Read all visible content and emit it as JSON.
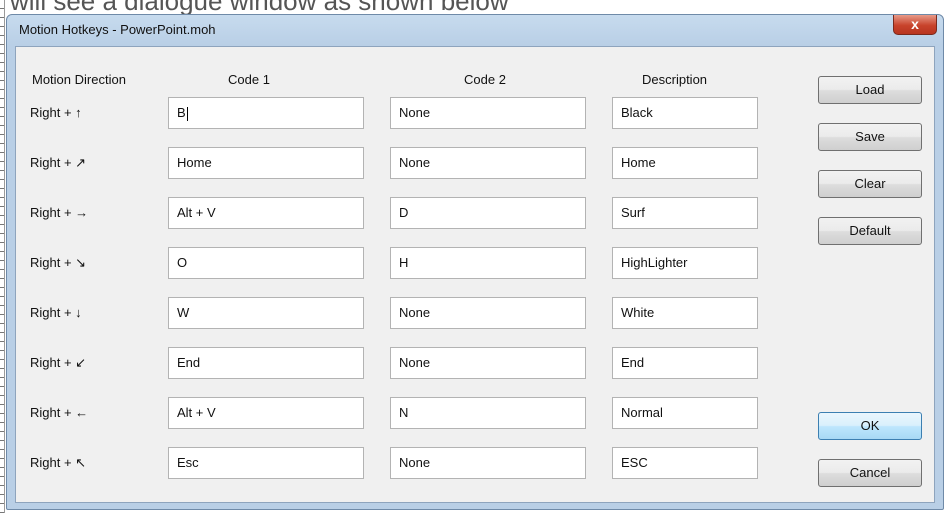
{
  "caption": "will see a dialogue window as shown below",
  "window": {
    "title": "Motion Hotkeys - PowerPoint.moh",
    "close_glyph": "x"
  },
  "headers": {
    "motion_direction": "Motion Direction",
    "code1": "Code 1",
    "code2": "Code 2",
    "description": "Description"
  },
  "rows": [
    {
      "direction": "Right + ↑",
      "code1": "B",
      "code2": "None",
      "description": "Black"
    },
    {
      "direction": "Right + ↗",
      "code1": "Home",
      "code2": "None",
      "description": "Home"
    },
    {
      "direction": "Right + →",
      "code1": "Alt + V",
      "code2": "D",
      "description": "Surf"
    },
    {
      "direction": "Right + ↘",
      "code1": "O",
      "code2": "H",
      "description": "HighLighter"
    },
    {
      "direction": "Right + ↓",
      "code1": "W",
      "code2": "None",
      "description": "White"
    },
    {
      "direction": "Right + ↙",
      "code1": "End",
      "code2": "None",
      "description": "End"
    },
    {
      "direction": "Right + ←",
      "code1": "Alt + V",
      "code2": "N",
      "description": "Normal"
    },
    {
      "direction": "Right + ↖",
      "code1": "Esc",
      "code2": "None",
      "description": "ESC"
    }
  ],
  "buttons": {
    "load": "Load",
    "save": "Save",
    "clear": "Clear",
    "default": "Default",
    "ok": "OK",
    "cancel": "Cancel"
  }
}
